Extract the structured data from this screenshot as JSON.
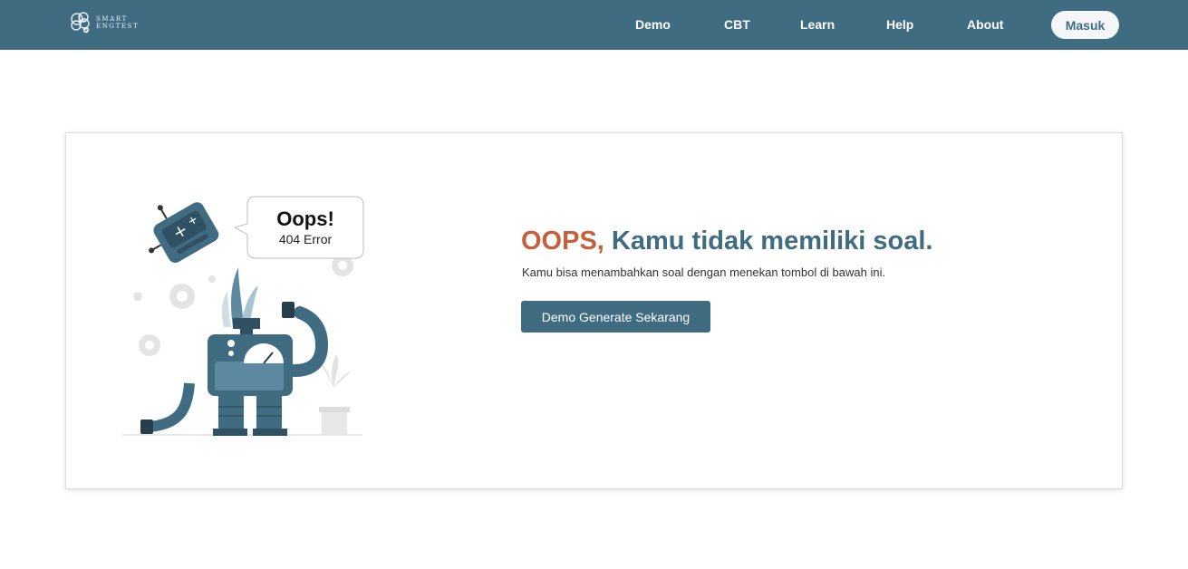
{
  "brand": {
    "line1": "SMART",
    "line2": "ENGTEST"
  },
  "nav": {
    "items": [
      {
        "label": "Demo"
      },
      {
        "label": "CBT"
      },
      {
        "label": "Learn"
      },
      {
        "label": "Help"
      },
      {
        "label": "About"
      }
    ],
    "login_label": "Masuk"
  },
  "illustration": {
    "bubble_title": "Oops!",
    "bubble_subtitle": "404 Error",
    "icon": "broken-robot-illustration"
  },
  "main": {
    "headline_accent": "OOPS,",
    "headline_rest": "Kamu tidak memiliki soal.",
    "description": "Kamu bisa menambahkan soal dengan menekan tombol di bawah ini.",
    "cta_label": "Demo Generate Sekarang"
  },
  "colors": {
    "primary": "#406c82",
    "accent": "#c65f3b",
    "background": "#ffffff"
  }
}
